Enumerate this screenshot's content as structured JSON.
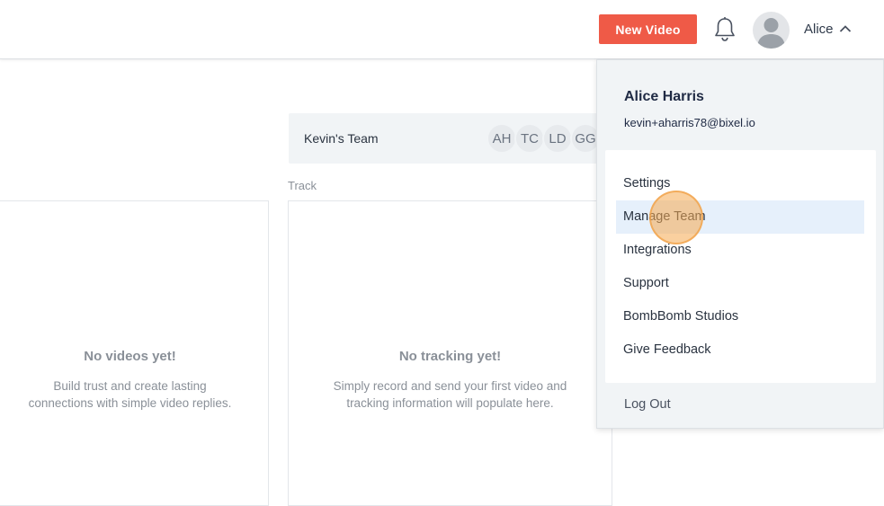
{
  "header": {
    "new_video_label": "New Video",
    "user_name": "Alice"
  },
  "team": {
    "name": "Kevin's Team",
    "members": [
      "AH",
      "TC",
      "LD",
      "GG"
    ]
  },
  "main": {
    "track_label": "Track",
    "videos_card": {
      "title": "No videos yet!",
      "line1": "Build trust and create lasting",
      "line2": "connections with simple video replies."
    },
    "tracking_card": {
      "title": "No tracking yet!",
      "line1": "Simply record and send your first video and",
      "line2": "tracking information will populate here."
    }
  },
  "dropdown": {
    "full_name": "Alice Harris",
    "email": "kevin+aharris78@bixel.io",
    "items": [
      {
        "label": "Settings"
      },
      {
        "label": "Manage Team"
      },
      {
        "label": "Integrations"
      },
      {
        "label": "Support"
      },
      {
        "label": "BombBomb Studios"
      },
      {
        "label": "Give Feedback"
      }
    ],
    "logout_label": "Log Out"
  },
  "colors": {
    "accent": "#ef5a47",
    "hover": "#e6f0fb",
    "panel": "#f1f4f6"
  }
}
